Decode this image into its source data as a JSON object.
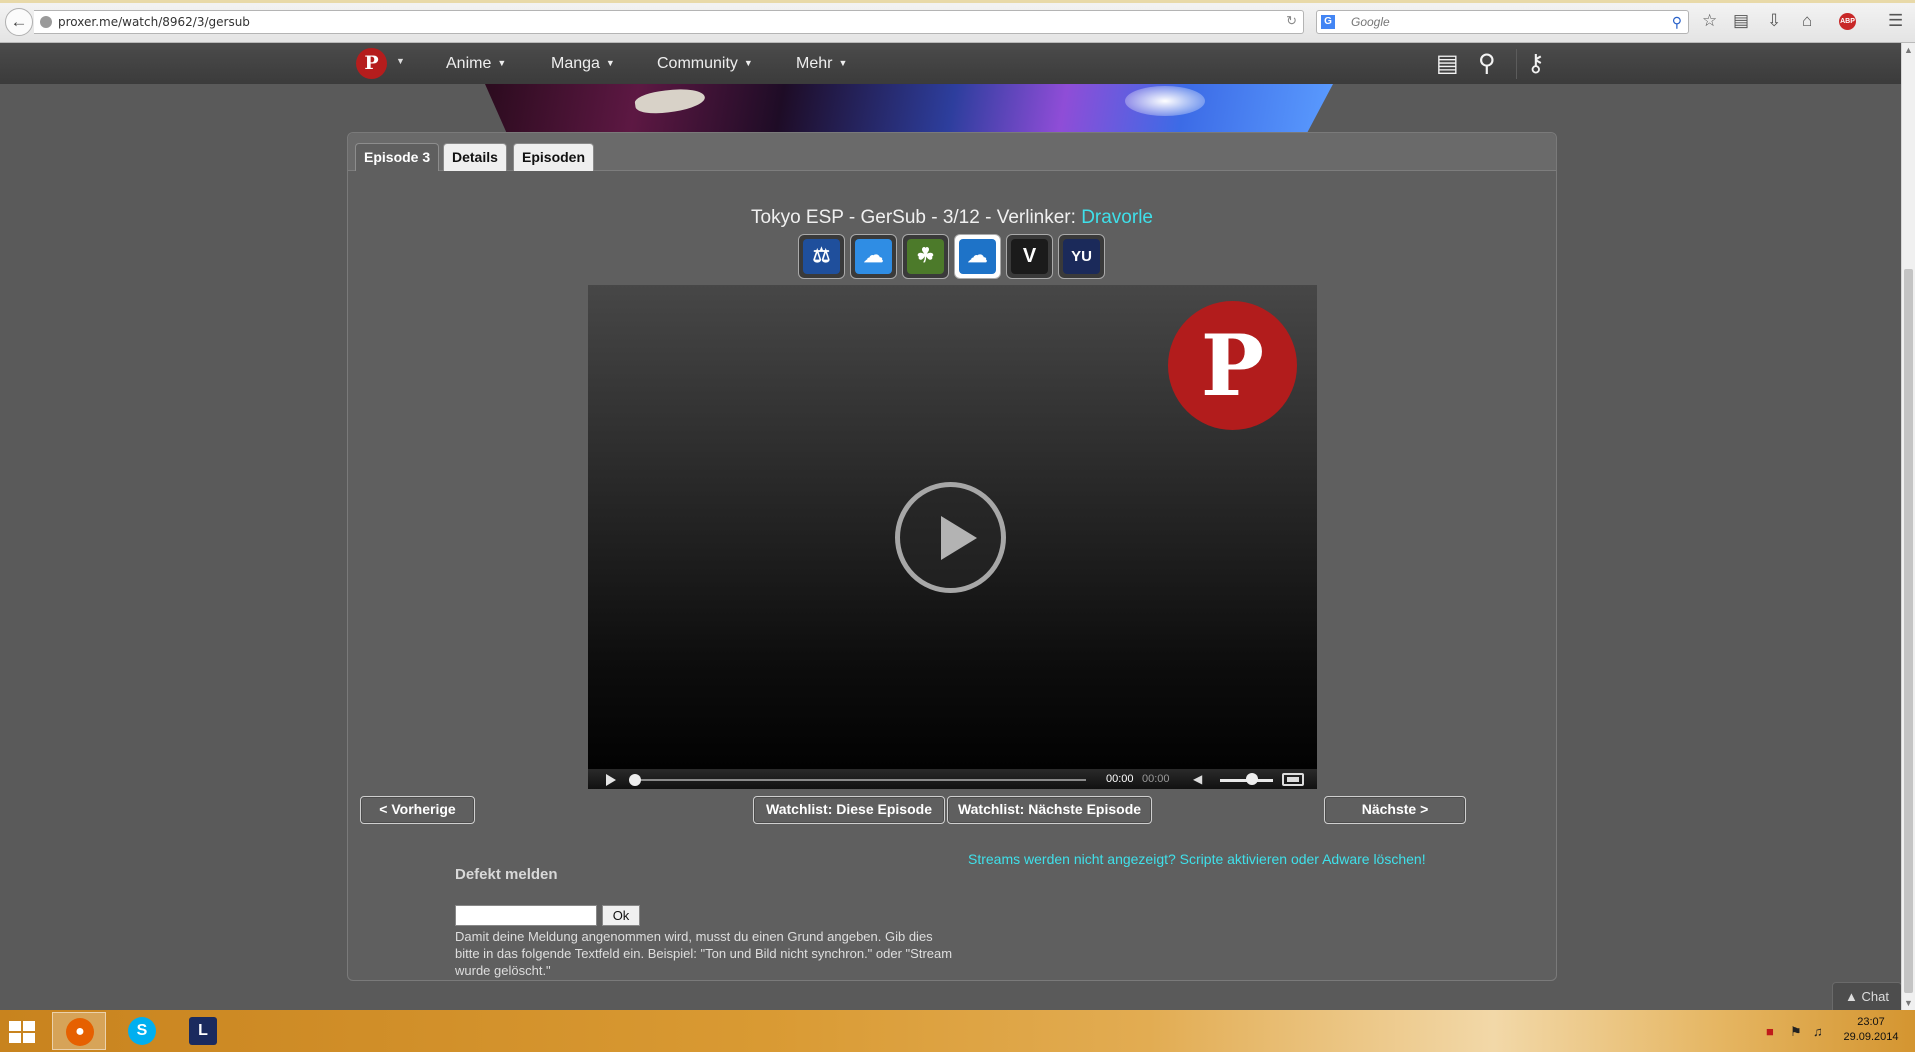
{
  "browser": {
    "url": "proxer.me/watch/8962/3/gersub",
    "search_placeholder": "Google",
    "back_glyph": "←",
    "reload_glyph": "↻",
    "addon_label": "ABP"
  },
  "site_nav": {
    "logo_letter": "P",
    "items": [
      {
        "label": "Anime"
      },
      {
        "label": "Manga"
      },
      {
        "label": "Community"
      },
      {
        "label": "Mehr"
      }
    ]
  },
  "tabs": [
    {
      "label": "Episode 3",
      "active": true
    },
    {
      "label": "Details",
      "active": false
    },
    {
      "label": "Episoden",
      "active": false
    }
  ],
  "video": {
    "title_prefix": "Tokyo ESP - GerSub - 3/12 - Verlinker: ",
    "uploader": "Dravorle",
    "current_time": "00:00",
    "duration": "00:00",
    "progress": 0,
    "volume": 0.6,
    "watermark_letter": "P"
  },
  "stream_hosts": [
    {
      "name": "host-a",
      "glyph": "⚖",
      "color": "#1f4f9c",
      "active": false
    },
    {
      "name": "host-b",
      "glyph": "☁",
      "color": "#2f8de4",
      "active": false
    },
    {
      "name": "host-c",
      "glyph": "☘",
      "color": "#4c7a2a",
      "active": false
    },
    {
      "name": "host-d",
      "glyph": "☁",
      "color": "#1e73c8",
      "active": true
    },
    {
      "name": "host-e",
      "glyph": "V",
      "color": "#1b1b1b",
      "active": false
    },
    {
      "name": "host-f",
      "glyph": "YU",
      "color": "#1b2a5a",
      "active": false
    }
  ],
  "actions": {
    "prev": "< Vorherige",
    "watchlist_this": "Watchlist: Diese Episode",
    "watchlist_next": "Watchlist: Nächste Episode",
    "next": "Nächste >"
  },
  "notice": "Streams werden nicht angezeigt? Scripte aktivieren oder Adware löschen!",
  "defekt": {
    "title": "Defekt melden",
    "input_value": "",
    "ok_label": "Ok",
    "hint": "Damit deine Meldung angenommen wird, musst du einen Grund angeben. Gib dies bitte in das folgende Textfeld ein. Beispiel: \"Ton und Bild nicht synchron.\" oder \"Stream wurde gelöscht.\""
  },
  "chat_label": "▲ Chat",
  "taskbar": {
    "apps": [
      {
        "name": "firefox",
        "glyph": "●",
        "color": "#e66000",
        "active": true
      },
      {
        "name": "skype",
        "glyph": "S",
        "color": "#00aff0",
        "active": false
      },
      {
        "name": "league-of-legends",
        "glyph": "L",
        "color": "#1a2a5e",
        "active": false
      }
    ],
    "time": "23:07",
    "date": "29.09.2014"
  },
  "colors": {
    "accent_link": "#3fe0ea",
    "nav_bg": "#3f3f3f",
    "panel_bg": "#5f5f5f",
    "logo_red": "#b51d1d"
  }
}
